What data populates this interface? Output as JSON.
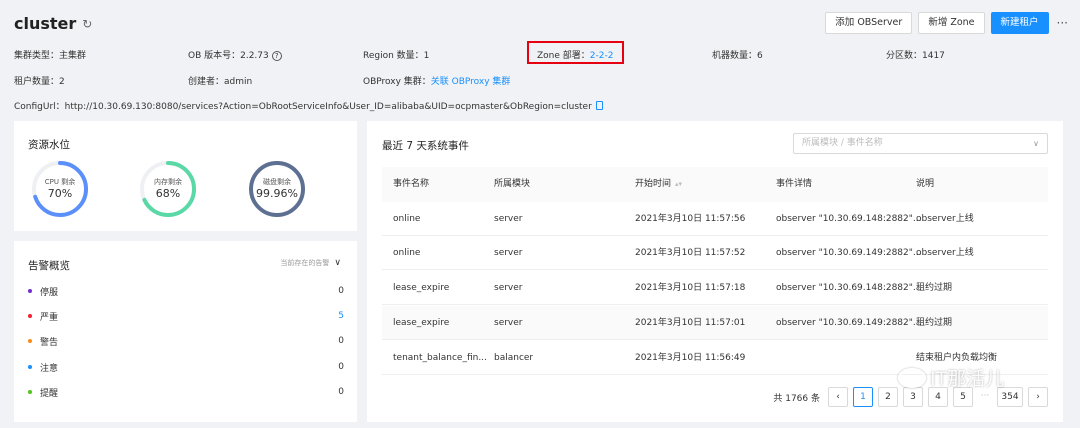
{
  "header": {
    "title": "cluster",
    "refresh_icon": "refresh-icon",
    "buttons": {
      "add_observer": "添加 OBServer",
      "add_zone": "新增 Zone",
      "new_tenant": "新建租户",
      "more": "···"
    },
    "info": {
      "cluster_type": "集群类型：主集群",
      "ob_version": "OB 版本号：2.2.73",
      "region_count": "Region 数量：1",
      "zone_deploy_label": "Zone 部署：",
      "zone_deploy_value": "2-2-2",
      "machine_count": "机器数量：6",
      "partition_count": "分区数：1417",
      "tenant_count": "租户数量：2",
      "creator": "创建者：admin",
      "obproxy_label": "OBProxy 集群：",
      "obproxy_link": "关联 OBProxy 集群",
      "config_url": "ConfigUrl：http://10.30.69.130:8080/services?Action=ObRootServiceInfo&User_ID=alibaba&UID=ocpmaster&ObRegion=cluster"
    }
  },
  "resources": {
    "title": "资源水位",
    "gauges": [
      {
        "label": "CPU 剩余",
        "value": "70%",
        "fraction": 0.7,
        "color": "#5b8ff9"
      },
      {
        "label": "内存剩余",
        "value": "68%",
        "fraction": 0.68,
        "color": "#5ad8a6"
      },
      {
        "label": "磁盘剩余",
        "value": "99.96%",
        "fraction": 0.9996,
        "color": "#5d7092"
      }
    ]
  },
  "alerts": {
    "title": "告警概览",
    "filter_label": "当前存在的告警",
    "items": [
      {
        "label": "停服",
        "count": "0",
        "color": "#722ed1"
      },
      {
        "label": "严重",
        "count": "5",
        "color": "#f5222d"
      },
      {
        "label": "警告",
        "count": "0",
        "color": "#fa8c16"
      },
      {
        "label": "注意",
        "count": "0",
        "color": "#1890ff"
      },
      {
        "label": "提醒",
        "count": "0",
        "color": "#52c41a"
      }
    ]
  },
  "events": {
    "title": "最近 7 天系统事件",
    "search_placeholder": "所属模块 / 事件名称",
    "columns": [
      "事件名称",
      "所属模块",
      "开始时间",
      "事件详情",
      "说明"
    ],
    "rows": [
      [
        "online",
        "server",
        "2021年3月10日 11:57:56",
        "observer \"10.30.69.148:2882\"...",
        "observer上线"
      ],
      [
        "online",
        "server",
        "2021年3月10日 11:57:52",
        "observer \"10.30.69.149:2882\"...",
        "observer上线"
      ],
      [
        "lease_expire",
        "server",
        "2021年3月10日 11:57:18",
        "observer \"10.30.69.148:2882\"...",
        "租约过期"
      ],
      [
        "lease_expire",
        "server",
        "2021年3月10日 11:57:01",
        "observer \"10.30.69.149:2882\"...",
        "租约过期"
      ],
      [
        "tenant_balance_fin...",
        "balancer",
        "2021年3月10日 11:56:49",
        "",
        "结束租户内负载均衡"
      ]
    ],
    "pagination": {
      "total": "共 1766 条",
      "pages": [
        "1",
        "2",
        "3",
        "4",
        "5",
        "···",
        "354"
      ],
      "current": "1",
      "prev": "‹",
      "next": "›"
    }
  },
  "watermark": "IT那活儿"
}
